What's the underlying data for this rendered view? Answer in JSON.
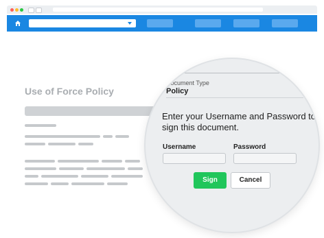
{
  "doc": {
    "title": "Use of Force Policy"
  },
  "dialog": {
    "doctype_label": "Document Type",
    "doctype_value": "Policy",
    "instruction": "Enter your Username and Password to sign this document.",
    "username_label": "Username",
    "password_label": "Password",
    "username_value": "",
    "password_value": "",
    "sign_label": "Sign",
    "cancel_label": "Cancel"
  },
  "icons": {
    "home": "home-icon",
    "dropdown": "chevron-down-icon"
  },
  "colors": {
    "appbar": "#1a87e2",
    "sign_button": "#20c65b",
    "lens_bg": "#eceef0"
  }
}
